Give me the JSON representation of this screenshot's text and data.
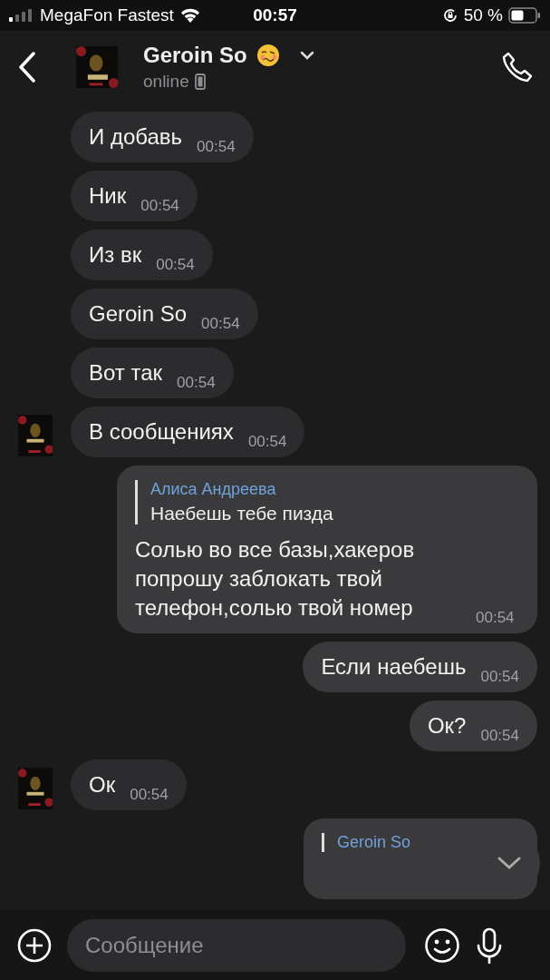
{
  "status_bar": {
    "carrier": "MegaFon Fastest",
    "time": "00:57",
    "battery": "50 %"
  },
  "header": {
    "name": "Geroin So",
    "status": "online"
  },
  "messages": [
    {
      "kind": "incoming",
      "avatar": false,
      "text": "И добавь",
      "time": "00:54"
    },
    {
      "kind": "incoming",
      "avatar": false,
      "text": "Ник",
      "time": "00:54"
    },
    {
      "kind": "incoming",
      "avatar": false,
      "text": "Из вк",
      "time": "00:54"
    },
    {
      "kind": "incoming",
      "avatar": false,
      "text": "Geroin So",
      "time": "00:54"
    },
    {
      "kind": "incoming",
      "avatar": false,
      "text": "Вот так",
      "time": "00:54"
    },
    {
      "kind": "incoming",
      "avatar": true,
      "text": "В сообщениях",
      "time": "00:54"
    },
    {
      "kind": "outgoing",
      "reply": {
        "author": "Алиса Андреева",
        "text": "Наебешь тебе пизда"
      },
      "text": "Солью во все базы,хакеров попрошу заблокать твой телефон,солью твой номер",
      "time": "00:54"
    },
    {
      "kind": "outgoing",
      "text": "Если наебешь",
      "time": "00:54"
    },
    {
      "kind": "outgoing",
      "text": "Ок?",
      "time": "00:54"
    },
    {
      "kind": "incoming",
      "avatar": true,
      "text": "Ок",
      "time": "00:54"
    },
    {
      "kind": "outgoing",
      "reply": {
        "author": "Geroin So"
      }
    }
  ],
  "composer": {
    "placeholder": "Сообщение"
  }
}
